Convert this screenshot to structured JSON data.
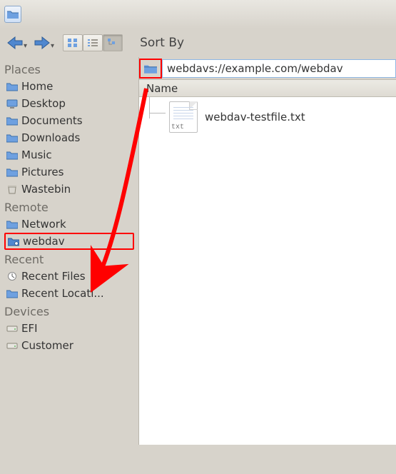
{
  "toolbar": {
    "sort_label": "Sort By"
  },
  "address": {
    "path": "webdavs://example.com/webdav"
  },
  "content": {
    "column_header": "Name",
    "files": [
      {
        "name": "webdav-testfile.txt",
        "ext": "txt"
      }
    ]
  },
  "sidebar": {
    "sections": [
      {
        "header": "Places",
        "items": [
          {
            "label": "Home",
            "icon": "folder"
          },
          {
            "label": "Desktop",
            "icon": "desktop"
          },
          {
            "label": "Documents",
            "icon": "folder"
          },
          {
            "label": "Downloads",
            "icon": "folder"
          },
          {
            "label": "Music",
            "icon": "folder"
          },
          {
            "label": "Pictures",
            "icon": "folder"
          },
          {
            "label": "Wastebin",
            "icon": "trash"
          }
        ]
      },
      {
        "header": "Remote",
        "items": [
          {
            "label": "Network",
            "icon": "folder"
          },
          {
            "label": "webdav",
            "icon": "remote",
            "highlight": true
          }
        ]
      },
      {
        "header": "Recent",
        "items": [
          {
            "label": "Recent Files",
            "icon": "clock"
          },
          {
            "label": "Recent Locati...",
            "icon": "folder"
          }
        ]
      },
      {
        "header": "Devices",
        "items": [
          {
            "label": "EFI",
            "icon": "drive"
          },
          {
            "label": "Customer",
            "icon": "drive"
          }
        ]
      }
    ]
  },
  "annot": {
    "color": "#ff0000"
  }
}
